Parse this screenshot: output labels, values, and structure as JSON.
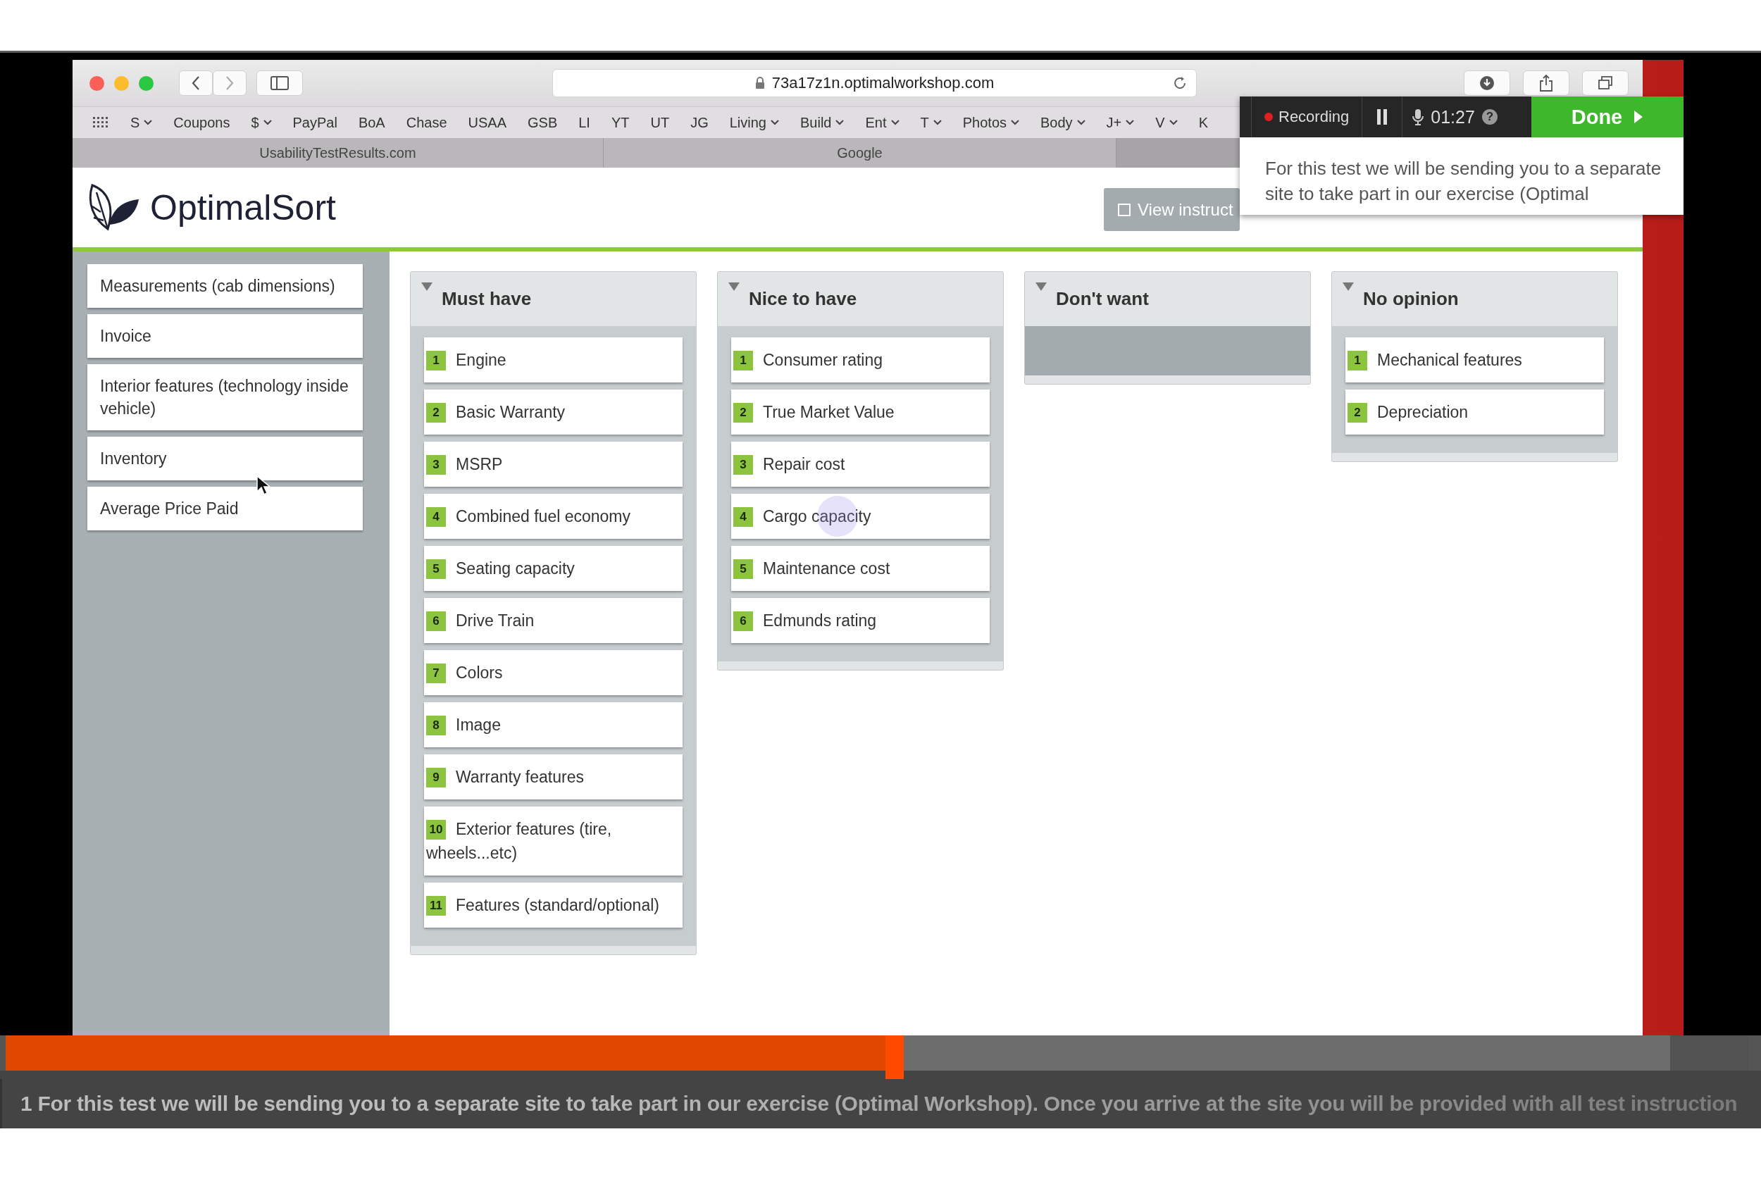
{
  "browser": {
    "url": "73a17z1n.optimalworkshop.com",
    "bookmarks": [
      {
        "label": "S",
        "menu": true
      },
      {
        "label": "Coupons",
        "menu": false
      },
      {
        "label": "$",
        "menu": true
      },
      {
        "label": "PayPal",
        "menu": false
      },
      {
        "label": "BoA",
        "menu": false
      },
      {
        "label": "Chase",
        "menu": false
      },
      {
        "label": "USAA",
        "menu": false
      },
      {
        "label": "GSB",
        "menu": false
      },
      {
        "label": "LI",
        "menu": false
      },
      {
        "label": "YT",
        "menu": false
      },
      {
        "label": "UT",
        "menu": false
      },
      {
        "label": "JG",
        "menu": false
      },
      {
        "label": "Living",
        "menu": true
      },
      {
        "label": "Build",
        "menu": true
      },
      {
        "label": "Ent",
        "menu": true
      },
      {
        "label": "T",
        "menu": true
      },
      {
        "label": "Photos",
        "menu": true
      },
      {
        "label": "Body",
        "menu": true
      },
      {
        "label": "J+",
        "menu": true
      },
      {
        "label": "V",
        "menu": true
      },
      {
        "label": "K",
        "menu": false
      }
    ],
    "tabs": [
      {
        "title": "UsabilityTestResults.com"
      },
      {
        "title": "Google"
      }
    ]
  },
  "header": {
    "logo": "OptimalSort",
    "instructions_button": "View instruct"
  },
  "unsorted_cards": [
    "Measurements (cab dimensions)",
    "Invoice",
    "Interior features (technology inside vehicle)",
    "Inventory",
    "Average Price Paid"
  ],
  "categories": [
    {
      "title": "Must have",
      "cards": [
        {
          "number": "1",
          "label": "Engine"
        },
        {
          "number": "2",
          "label": "Basic Warranty"
        },
        {
          "number": "3",
          "label": "MSRP"
        },
        {
          "number": "4",
          "label": "Combined fuel economy"
        },
        {
          "number": "5",
          "label": "Seating capacity"
        },
        {
          "number": "6",
          "label": "Drive Train"
        },
        {
          "number": "7",
          "label": "Colors"
        },
        {
          "number": "8",
          "label": "Image"
        },
        {
          "number": "9",
          "label": "Warranty features"
        },
        {
          "number": "10",
          "label": "Exterior features (tire, wheels...etc)"
        },
        {
          "number": "11",
          "label": "Features (standard/optional)"
        }
      ]
    },
    {
      "title": "Nice to have",
      "cards": [
        {
          "number": "1",
          "label": "Consumer rating"
        },
        {
          "number": "2",
          "label": "True Market Value"
        },
        {
          "number": "3",
          "label": "Repair cost"
        },
        {
          "number": "4",
          "label": "Cargo capacity"
        },
        {
          "number": "5",
          "label": "Maintenance cost"
        },
        {
          "number": "6",
          "label": "Edmunds rating"
        }
      ]
    },
    {
      "title": "Don't want"
    },
    {
      "title": "No opinion",
      "cards": [
        {
          "number": "1",
          "label": "Mechanical features"
        },
        {
          "number": "2",
          "label": "Depreciation"
        }
      ]
    }
  ],
  "recorder": {
    "status": "Recording",
    "time": "01:27",
    "help": "?",
    "done": "Done",
    "instructions": "For this test we will be sending you to a separate site to take part in our exercise (Optimal"
  },
  "playback": {
    "level": 0.51,
    "caption": "1 For this test we will be sending you to a separate site to take part in our exercise (Optimal Workshop). Once you arrive at the site you will be provided with all test instruction"
  }
}
